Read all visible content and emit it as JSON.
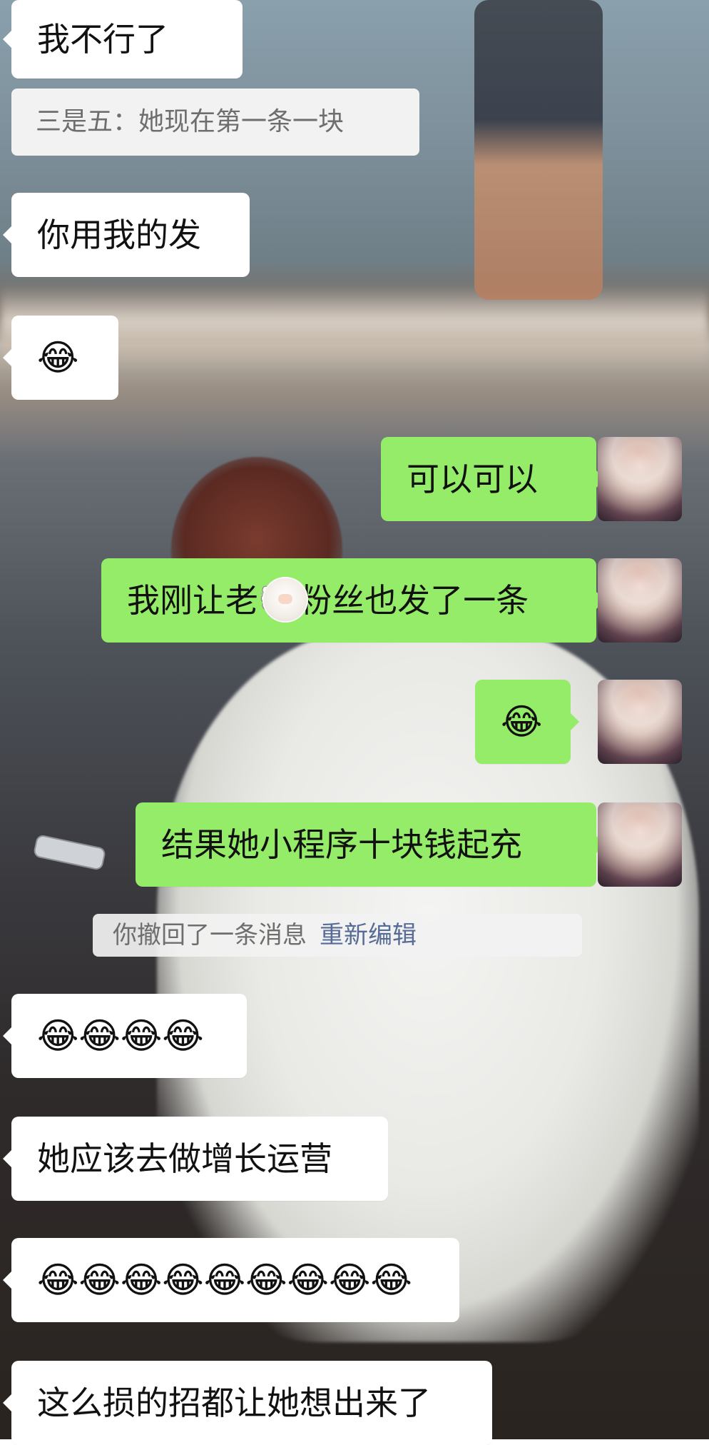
{
  "messages": {
    "in_1": "我不行了",
    "quote": "三是五：她现在第一条一块",
    "in_2": "你用我的发",
    "in_3": "😂",
    "out_1": "可以可以",
    "out_2": "我刚让老🐑粉丝也发了一条",
    "out_3": "😂",
    "out_4": "结果她小程序十块钱起充",
    "recall_text": "你撤回了一条消息",
    "recall_link": "重新编辑",
    "in_4": "😂😂😂😂",
    "in_5": "她应该去做增长运营",
    "in_6": "😂😂😂😂😂😂😂😂😂",
    "in_7": "这么损的招都让她想出来了"
  },
  "icons": {
    "avatar": "user-avatar-icon",
    "sticker": "sheep-sticker-icon"
  },
  "colors": {
    "incoming_bubble": "#ffffff",
    "outgoing_bubble": "#95ec69",
    "link": "#576b95"
  }
}
